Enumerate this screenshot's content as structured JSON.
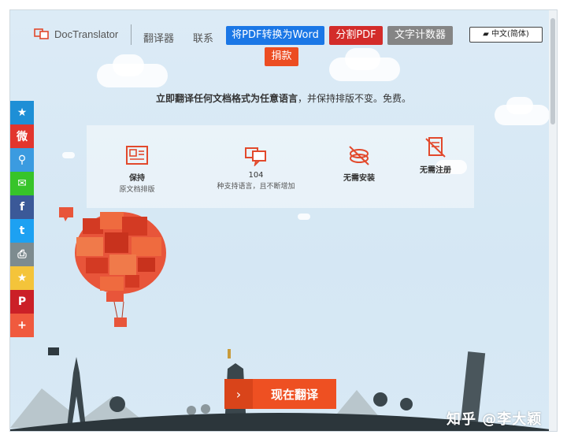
{
  "header": {
    "brand": "DocTranslator",
    "nav": [
      "翻译器",
      "联系"
    ],
    "buttons": {
      "to_word": "将PDF转换为Word",
      "split_pdf": "分割PDF",
      "word_counter": "文字计数器",
      "donate": "捐款"
    },
    "language_selector": "中文(简体)"
  },
  "tagline": {
    "bold": "立即翻译任何文档格式为任意语言",
    "rest": "，并保持排版不变。免费。"
  },
  "features": [
    {
      "title": "保持",
      "subtitle": "原文档排版",
      "icon": "layout-icon"
    },
    {
      "title": "104",
      "subtitle": "种支持语言，且不断增加",
      "icon": "speech-bubbles-icon"
    },
    {
      "title": "无需安装",
      "subtitle": "",
      "icon": "no-install-icon"
    },
    {
      "title": "无需注册",
      "subtitle": "",
      "icon": "no-register-icon"
    }
  ],
  "social": [
    {
      "name": "favorite-icon",
      "glyph": "★",
      "color": "#1e8fd6"
    },
    {
      "name": "weibo-icon",
      "glyph": "微",
      "color": "#e2352d"
    },
    {
      "name": "people-icon",
      "glyph": "⚲",
      "color": "#3b9be0"
    },
    {
      "name": "wechat-icon",
      "glyph": "✉",
      "color": "#37c42a"
    },
    {
      "name": "facebook-icon",
      "glyph": "f",
      "color": "#3b5998"
    },
    {
      "name": "twitter-icon",
      "glyph": "t",
      "color": "#1da1f2"
    },
    {
      "name": "print-icon",
      "glyph": "⎙",
      "color": "#7d8b8f"
    },
    {
      "name": "star-icon",
      "glyph": "★",
      "color": "#f4c43a"
    },
    {
      "name": "pinterest-icon",
      "glyph": "P",
      "color": "#cb2027"
    },
    {
      "name": "more-icon",
      "glyph": "+",
      "color": "#f05a3e"
    }
  ],
  "cta": {
    "arrow": "›",
    "label": "现在翻译"
  },
  "watermark": "知乎 @李大颖",
  "colors": {
    "accent": "#ee5022",
    "blue": "#1b77e6",
    "red": "#d32c2a",
    "gray": "#858585"
  }
}
